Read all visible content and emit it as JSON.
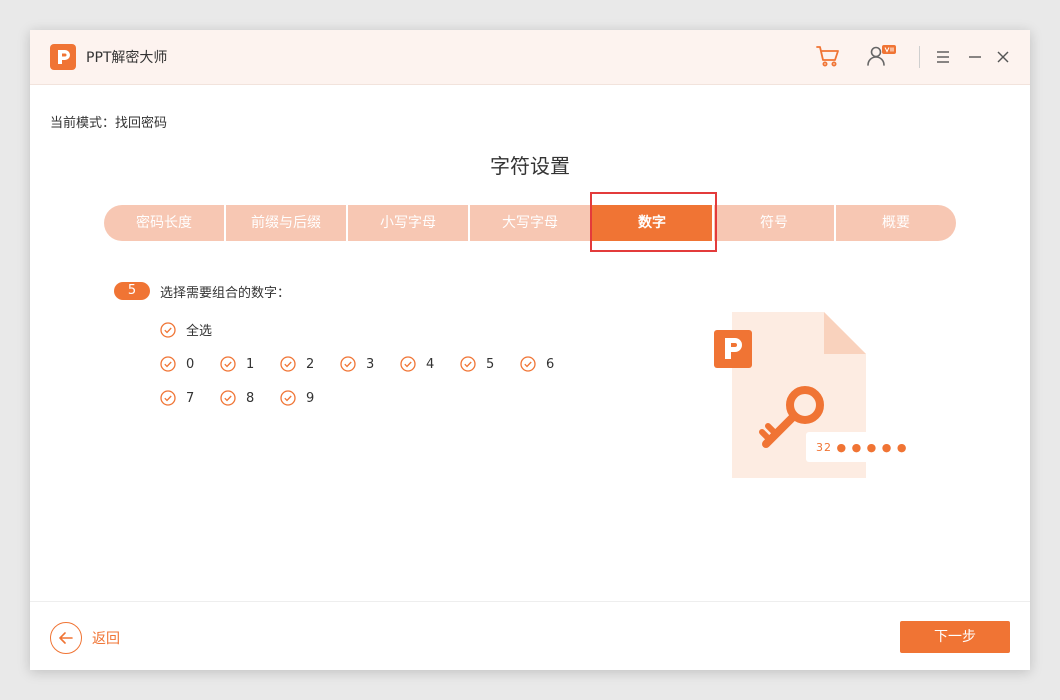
{
  "app": {
    "title": "PPT解密大师",
    "logo_letter": "P"
  },
  "titlebar": {
    "icons": [
      "cart-icon",
      "user-vip-icon",
      "menu-icon",
      "minimize-icon",
      "close-icon"
    ],
    "vip_badge": "VIP"
  },
  "mode": {
    "text": "当前模式：找回密码"
  },
  "page": {
    "title": "字符设置"
  },
  "steps": [
    {
      "label": "密码长度",
      "active": false
    },
    {
      "label": "前缀与后缀",
      "active": false
    },
    {
      "label": "小写字母",
      "active": false
    },
    {
      "label": "大写字母",
      "active": false
    },
    {
      "label": "数字",
      "active": true
    },
    {
      "label": "符号",
      "active": false
    },
    {
      "label": "概要",
      "active": false
    }
  ],
  "section": {
    "badge": "5",
    "label": "选择需要组合的数字：",
    "select_all": "全选",
    "digits_row1": [
      "0",
      "1",
      "2",
      "3",
      "4",
      "5",
      "6"
    ],
    "digits_row2": [
      "7",
      "8",
      "9"
    ]
  },
  "illustration": {
    "pw_text": "32 ● ● ● ● ●"
  },
  "footer": {
    "back_label": "返回",
    "next_label": "下一步"
  },
  "colors": {
    "accent": "#f07434",
    "accent_light": "#f7c7b3",
    "highlight": "#e33b3b",
    "titlebar_bg": "#fdf3ef"
  }
}
